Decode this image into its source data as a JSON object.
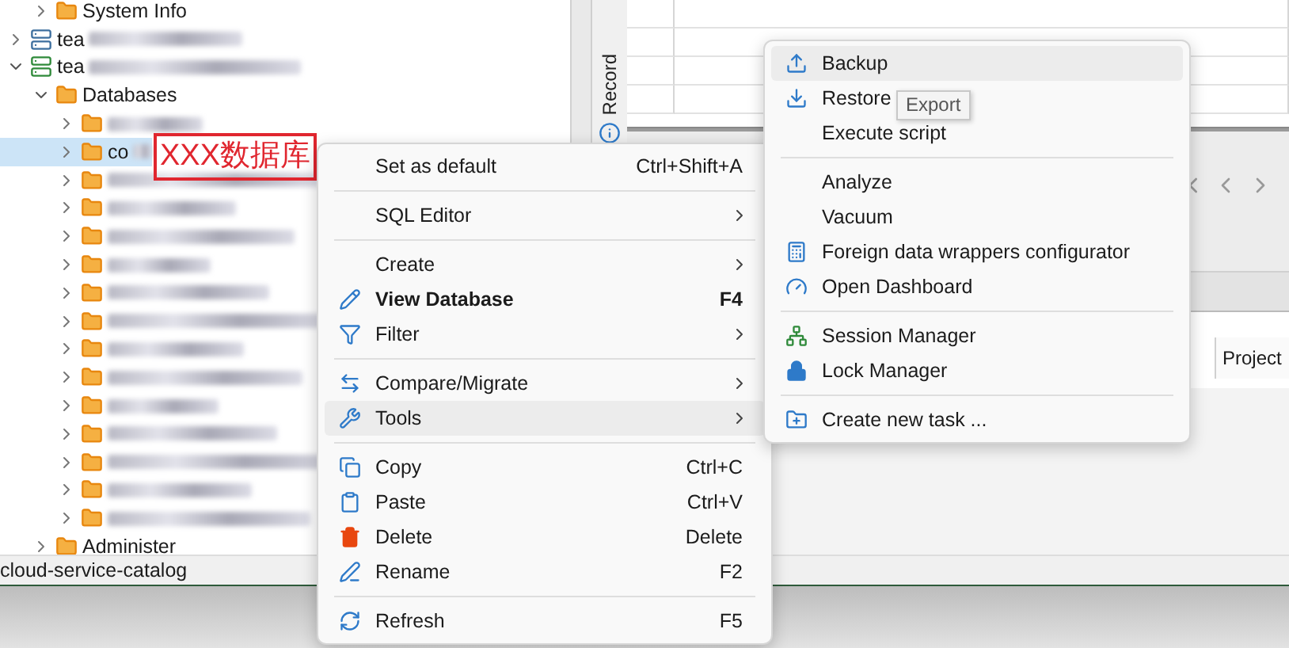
{
  "tree": {
    "items": [
      {
        "children": [
          {
            "label": "System Info",
            "expanded": false,
            "selected": false
          }
        ]
      },
      {
        "label": "tea",
        "redacted": true,
        "expanded": false,
        "selected": false,
        "connected": false
      },
      {
        "label": "tea",
        "redacted": true,
        "expanded": true,
        "selected": false,
        "connected": true,
        "children": [
          {
            "label": "Databases",
            "expanded": true,
            "selected": false,
            "children": [
              {
                "redacted": true,
                "expanded": false,
                "selected": false
              },
              {
                "label": "co",
                "redacted": true,
                "expanded": false,
                "selected": true
              },
              {
                "redacted": true,
                "expanded": false,
                "selected": false
              },
              {
                "redacted": true,
                "expanded": false,
                "selected": false
              },
              {
                "redacted": true,
                "expanded": false,
                "selected": false
              },
              {
                "redacted": true,
                "expanded": false,
                "selected": false
              },
              {
                "redacted": true,
                "expanded": false,
                "selected": false
              },
              {
                "redacted": true,
                "expanded": false,
                "selected": false
              },
              {
                "redacted": true,
                "expanded": false,
                "selected": false
              },
              {
                "redacted": true,
                "expanded": false,
                "selected": false
              },
              {
                "redacted": true,
                "expanded": false,
                "selected": false
              },
              {
                "redacted": true,
                "expanded": false,
                "selected": false
              },
              {
                "redacted": true,
                "expanded": false,
                "selected": false
              },
              {
                "redacted": true,
                "expanded": false,
                "selected": false
              },
              {
                "redacted": true,
                "expanded": false,
                "selected": false
              }
            ]
          },
          {
            "label": "Administer",
            "expanded": false,
            "selected": false
          }
        ]
      }
    ]
  },
  "annotation": "XXX数据库",
  "side_tab": "Record",
  "column_header": "Project",
  "status_bar": "cloud-service-catalog",
  "context_menu": {
    "items": [
      {
        "kind": "item",
        "label": "Set as default",
        "shortcut": "Ctrl+Shift+A",
        "submenu": false,
        "bold": false,
        "selected": false
      },
      {
        "kind": "separator"
      },
      {
        "kind": "item",
        "label": "SQL Editor",
        "submenu": true,
        "bold": false,
        "selected": false
      },
      {
        "kind": "separator"
      },
      {
        "kind": "item",
        "label": "Create",
        "submenu": true,
        "bold": false,
        "selected": false
      },
      {
        "kind": "item",
        "label": "View Database",
        "shortcut": "F4",
        "submenu": false,
        "bold": true,
        "selected": false
      },
      {
        "kind": "item",
        "label": "Filter",
        "submenu": true,
        "bold": false,
        "selected": false
      },
      {
        "kind": "separator"
      },
      {
        "kind": "item",
        "label": "Compare/Migrate",
        "submenu": true,
        "bold": false,
        "selected": false
      },
      {
        "kind": "item",
        "label": "Tools",
        "submenu": true,
        "bold": false,
        "selected": true
      },
      {
        "kind": "separator"
      },
      {
        "kind": "item",
        "label": "Copy",
        "shortcut": "Ctrl+C",
        "submenu": false,
        "bold": false,
        "selected": false
      },
      {
        "kind": "item",
        "label": "Paste",
        "shortcut": "Ctrl+V",
        "submenu": false,
        "bold": false,
        "selected": false
      },
      {
        "kind": "item",
        "label": "Delete",
        "shortcut": "Delete",
        "submenu": false,
        "bold": false,
        "selected": false
      },
      {
        "kind": "item",
        "label": "Rename",
        "shortcut": "F2",
        "submenu": false,
        "bold": false,
        "selected": false
      },
      {
        "kind": "separator"
      },
      {
        "kind": "item",
        "label": "Refresh",
        "shortcut": "F5",
        "submenu": false,
        "bold": false,
        "selected": false
      }
    ]
  },
  "tools_submenu": {
    "items": [
      {
        "kind": "item",
        "label": "Backup",
        "selected": true
      },
      {
        "kind": "item",
        "label": "Restore",
        "selected": false
      },
      {
        "kind": "item",
        "label": "Execute script",
        "selected": false
      },
      {
        "kind": "separator"
      },
      {
        "kind": "item",
        "label": "Analyze",
        "selected": false
      },
      {
        "kind": "item",
        "label": "Vacuum",
        "selected": false
      },
      {
        "kind": "item",
        "label": "Foreign data wrappers configurator",
        "selected": false
      },
      {
        "kind": "item",
        "label": "Open Dashboard",
        "selected": false
      },
      {
        "kind": "separator"
      },
      {
        "kind": "item",
        "label": "Session Manager",
        "selected": false
      },
      {
        "kind": "item",
        "label": "Lock Manager",
        "selected": false
      },
      {
        "kind": "separator"
      },
      {
        "kind": "item",
        "label": "Create new task ...",
        "selected": false
      }
    ]
  },
  "tooltip": "Export"
}
